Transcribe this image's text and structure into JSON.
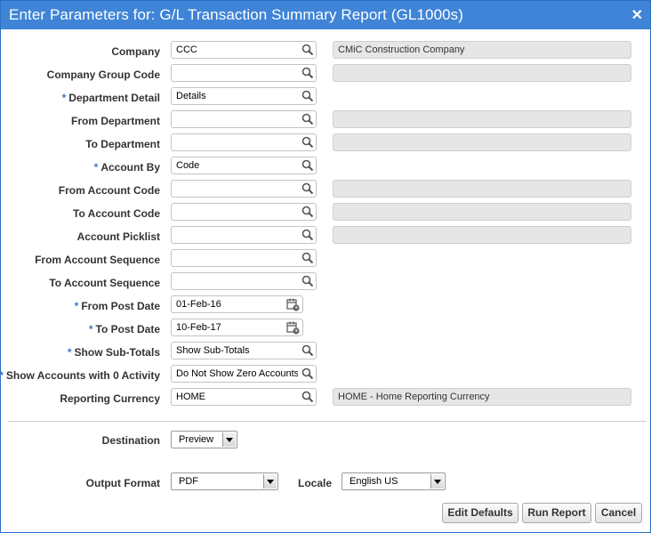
{
  "dialog": {
    "title": "Enter Parameters for: G/L Transaction Summary Report (GL1000s)",
    "close_glyph": "✕"
  },
  "fields": [
    {
      "label": "Company",
      "required": false,
      "value": "CCC",
      "desc": "CMiC Construction Company",
      "has_desc": true,
      "kind": "lookup"
    },
    {
      "label": "Company Group Code",
      "required": false,
      "value": "",
      "desc": "",
      "has_desc": true,
      "kind": "lookup"
    },
    {
      "label": "Department Detail",
      "required": true,
      "value": "Details",
      "has_desc": false,
      "kind": "lookup"
    },
    {
      "label": "From Department",
      "required": false,
      "value": "",
      "desc": "",
      "has_desc": true,
      "kind": "lookup"
    },
    {
      "label": "To Department",
      "required": false,
      "value": "",
      "desc": "",
      "has_desc": true,
      "kind": "lookup"
    },
    {
      "label": "Account By",
      "required": true,
      "value": "Code",
      "has_desc": false,
      "kind": "lookup"
    },
    {
      "label": "From Account Code",
      "required": false,
      "value": "",
      "desc": "",
      "has_desc": true,
      "kind": "lookup"
    },
    {
      "label": "To Account Code",
      "required": false,
      "value": "",
      "desc": "",
      "has_desc": true,
      "kind": "lookup"
    },
    {
      "label": "Account Picklist",
      "required": false,
      "value": "",
      "desc": "",
      "has_desc": true,
      "kind": "lookup"
    },
    {
      "label": "From Account Sequence",
      "required": false,
      "value": "",
      "has_desc": false,
      "kind": "lookup"
    },
    {
      "label": "To Account Sequence",
      "required": false,
      "value": "",
      "has_desc": false,
      "kind": "lookup"
    },
    {
      "label": "From Post Date",
      "required": true,
      "value": "01-Feb-16",
      "has_desc": false,
      "kind": "date"
    },
    {
      "label": "To Post Date",
      "required": true,
      "value": "10-Feb-17",
      "has_desc": false,
      "kind": "date"
    },
    {
      "label": "Show Sub-Totals",
      "required": true,
      "value": "Show Sub-Totals",
      "has_desc": false,
      "kind": "lookup"
    },
    {
      "label": "Show Accounts with 0 Activity",
      "required": true,
      "value": "Do Not Show Zero Accounts",
      "has_desc": false,
      "kind": "lookup"
    },
    {
      "label": "Reporting Currency",
      "required": false,
      "value": "HOME",
      "desc": "HOME - Home Reporting Currency",
      "has_desc": true,
      "kind": "lookup"
    }
  ],
  "required_marker": "*",
  "destination": {
    "label": "Destination",
    "value": "Preview"
  },
  "output_format": {
    "label": "Output Format",
    "value": "PDF"
  },
  "locale": {
    "label": "Locale",
    "value": "English US"
  },
  "buttons": {
    "edit_defaults": "Edit Defaults",
    "run_report": "Run Report",
    "cancel": "Cancel"
  },
  "colors": {
    "title_bar": "#3f84d6",
    "required_marker": "#3b78c6",
    "readonly_bg": "#e6e6e6"
  },
  "icons": {
    "lookup": "search-icon",
    "date": "calendar-icon",
    "close": "close-icon",
    "dropdown": "chevron-down-icon"
  }
}
